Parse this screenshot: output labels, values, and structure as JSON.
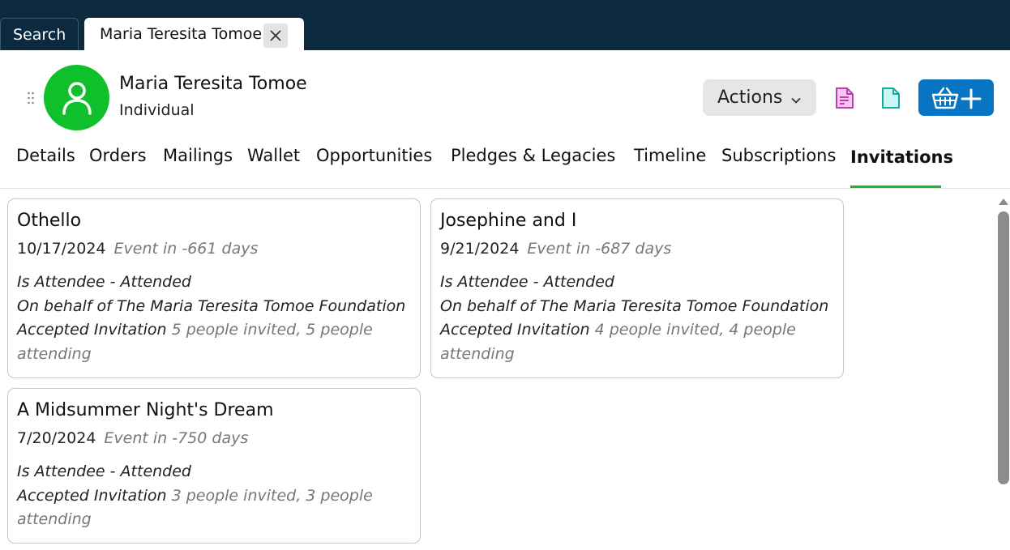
{
  "top_tabs": {
    "search_label": "Search",
    "person_label": "Maria Teresita Tomoe"
  },
  "header": {
    "name": "Maria Teresita Tomoe",
    "constituent_type": "Individual",
    "actions_label": "Actions",
    "avatar_color": "#10bf2c",
    "accent_color": "#0775c4"
  },
  "nav_tabs": [
    {
      "label": "Details"
    },
    {
      "label": "Orders"
    },
    {
      "label": "Mailings"
    },
    {
      "label": "Wallet"
    },
    {
      "label": "Opportunities"
    },
    {
      "label": "Pledges & Legacies"
    },
    {
      "label": "Timeline"
    },
    {
      "label": "Subscriptions"
    },
    {
      "label": "Invitations",
      "active": true
    }
  ],
  "invitations": [
    {
      "title": "Othello",
      "date": "10/17/2024",
      "relative": "Event in -661 days",
      "role": "Is Attendee - Attended",
      "on_behalf": "On behalf of The Maria Teresita Tomoe Foundation",
      "status": "Accepted Invitation",
      "attendance_1": "5 people invited, 5 people",
      "attendance_2": "attending"
    },
    {
      "title": "Josephine and I",
      "date": "9/21/2024",
      "relative": "Event in -687 days",
      "role": "Is Attendee - Attended",
      "on_behalf": "On behalf of The Maria Teresita Tomoe Foundation",
      "status": "Accepted Invitation",
      "attendance_1": "4 people invited, 4 people",
      "attendance_2": "attending"
    },
    {
      "title": "A Midsummer Night's Dream",
      "date": "7/20/2024",
      "relative": "Event in -750 days",
      "role": "Is Attendee - Attended",
      "status": "Accepted Invitation",
      "attendance_1": "3 people invited, 3 people",
      "attendance_2": "attending"
    }
  ],
  "icons": {
    "close": "close-icon",
    "drag": "drag-handle-icon",
    "avatar": "person-icon",
    "chevron": "chevron-down-icon",
    "doc_pink": "document-lines-icon",
    "doc_teal": "document-icon",
    "basket": "basket-add-icon"
  }
}
